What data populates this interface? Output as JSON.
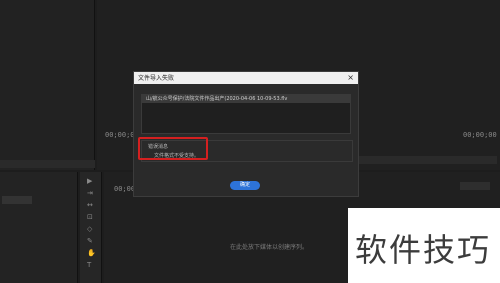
{
  "program_monitor": {
    "timecode_left": "00;00;00",
    "timecode_right": "00;00;00"
  },
  "timeline": {
    "timecode": "00;00",
    "drop_hint": "在此处放下媒体以创建序列。"
  },
  "dialog": {
    "title": "文件导入失败",
    "close_symbol": "×",
    "file_name": "山/航公众号保护/法院文件作品出产(2020-04-06 10-09-53.flv",
    "error_heading": "错误消息",
    "error_message": "文件格式不受支持。",
    "ok_label": "确定"
  },
  "tools": [
    "▶",
    "⇥",
    "↔",
    "⊡",
    "◇",
    "✎",
    "✋",
    "T"
  ],
  "watermark": "软件技巧",
  "colors": {
    "accent": "#2d73d8",
    "highlight": "#d42020",
    "background": "#1d1d1d"
  }
}
